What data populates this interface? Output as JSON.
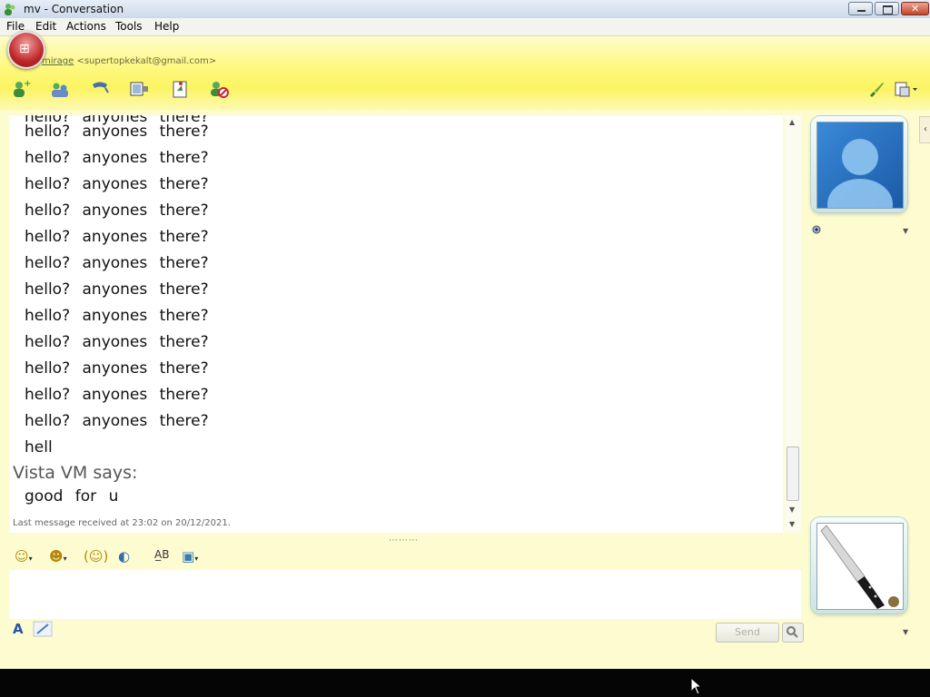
{
  "window": {
    "title": "mv - Conversation",
    "controls": {
      "minimize": "minimize",
      "maximize": "maximize",
      "close": "close"
    }
  },
  "menu": [
    "File",
    "Edit",
    "Actions",
    "Tools",
    "Help"
  ],
  "contact": {
    "name": "mirage",
    "email": "<supertopkekalt@gmail.com>"
  },
  "toolbar": {
    "icons": [
      "invite-contact-icon",
      "share-files-icon",
      "call-icon",
      "video-icon",
      "games-icon",
      "block-icon"
    ]
  },
  "history": {
    "repeat_line": "hello? anyones there?",
    "repeat_count": 12,
    "partial_line": "hell",
    "sender": "Vista VM says:",
    "reply": "good for u",
    "last_message": "Last message received at 23:02 on 20/12/2021."
  },
  "compose": {
    "send_label": "Send",
    "font_label": "A"
  }
}
